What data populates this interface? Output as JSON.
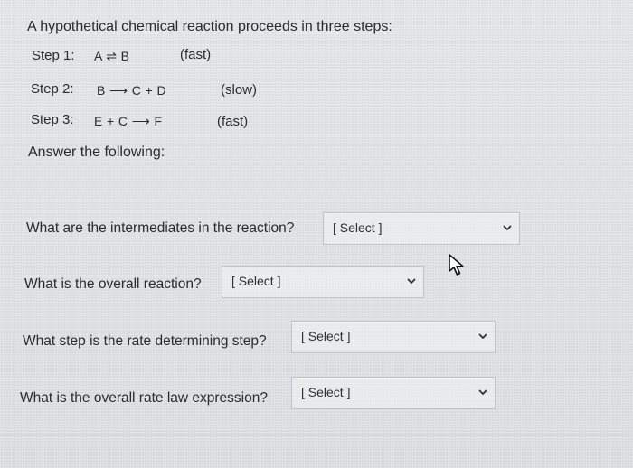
{
  "question": {
    "heading": "A hypothetical chemical reaction proceeds in three steps:",
    "steps": [
      {
        "label": "Step 1:",
        "reaction": "A ⇌ B",
        "speed": "(fast)"
      },
      {
        "label": "Step 2:",
        "reaction": "B ⟶ C + D",
        "speed": "(slow)"
      },
      {
        "label": "Step 3:",
        "reaction": "E + C ⟶ F",
        "speed": "(fast)"
      }
    ],
    "answer_prompt": "Answer the following:"
  },
  "items": [
    {
      "question": "What are the intermediates in the reaction?",
      "select_value": "[ Select ]"
    },
    {
      "question": "What is the overall reaction?",
      "select_value": "[ Select ]"
    },
    {
      "question": "What step is the rate determining step?",
      "select_value": "[ Select ]"
    },
    {
      "question": "What is the overall rate law expression?",
      "select_value": "[ Select ]"
    }
  ],
  "icons": {
    "dropdown": "chevron-down-icon",
    "pointer": "mouse-pointer-icon"
  }
}
